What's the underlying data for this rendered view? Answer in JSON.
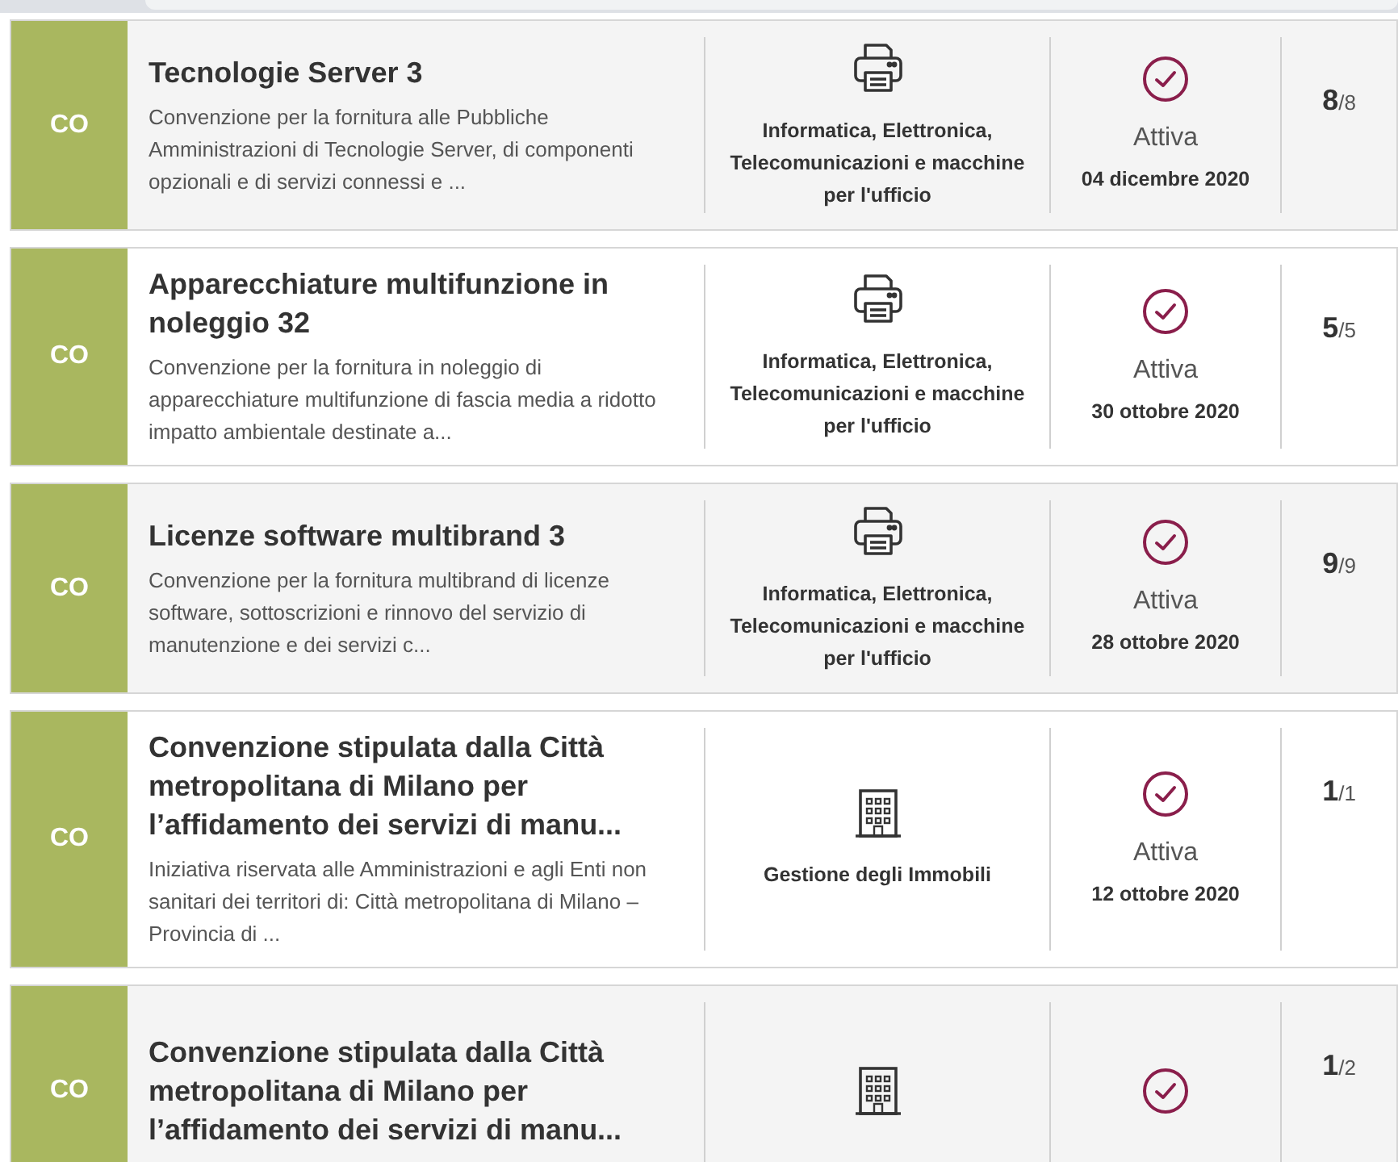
{
  "rows": [
    {
      "type_code": "CO",
      "title": "Tecnologie Server 3",
      "description": "Convenzione per la fornitura alle Pubbliche Amministrazioni di Tecnologie Server, di componenti opzionali e di servizi connessi e ...",
      "kind": "printer",
      "category": "Informatica, Elettronica, Telecomunicazioni e macchine per l'ufficio",
      "status": "Attiva",
      "date": "04 dicembre 2020",
      "count": "8",
      "total": "/8"
    },
    {
      "type_code": "CO",
      "title": "Apparecchiature multifunzione in noleggio 32",
      "description": "Convenzione per la fornitura in noleggio di apparecchiature multifunzione di fascia media a ridotto impatto ambientale destinate a...",
      "kind": "printer",
      "category": "Informatica, Elettronica, Telecomunicazioni e macchine per l'ufficio",
      "status": "Attiva",
      "date": "30 ottobre 2020",
      "count": "5",
      "total": "/5"
    },
    {
      "type_code": "CO",
      "title": "Licenze software multibrand 3",
      "description": "Convenzione per la fornitura multibrand di licenze software, sottoscrizioni e rinnovo del servizio di manutenzione e dei servizi c...",
      "kind": "printer",
      "category": "Informatica, Elettronica, Telecomunicazioni e macchine per l'ufficio",
      "status": "Attiva",
      "date": "28 ottobre 2020",
      "count": "9",
      "total": "/9"
    },
    {
      "type_code": "CO",
      "title": "Convenzione stipulata dalla Città metropolitana di Milano per l’affidamento dei servizi di manu...",
      "description": "Iniziativa riservata alle Amministrazioni e agli Enti non sanitari dei territori di: Città metropolitana di Milano – Provincia di ...",
      "kind": "building",
      "category": "Gestione degli Immobili",
      "status": "Attiva",
      "date": "12 ottobre 2020",
      "count": "1",
      "total": "/1"
    },
    {
      "type_code": "CO",
      "title": "Convenzione stipulata dalla Città metropolitana di Milano per l’affidamento dei servizi di manu...",
      "kind": "building",
      "count": "1",
      "total": "/2"
    }
  ]
}
